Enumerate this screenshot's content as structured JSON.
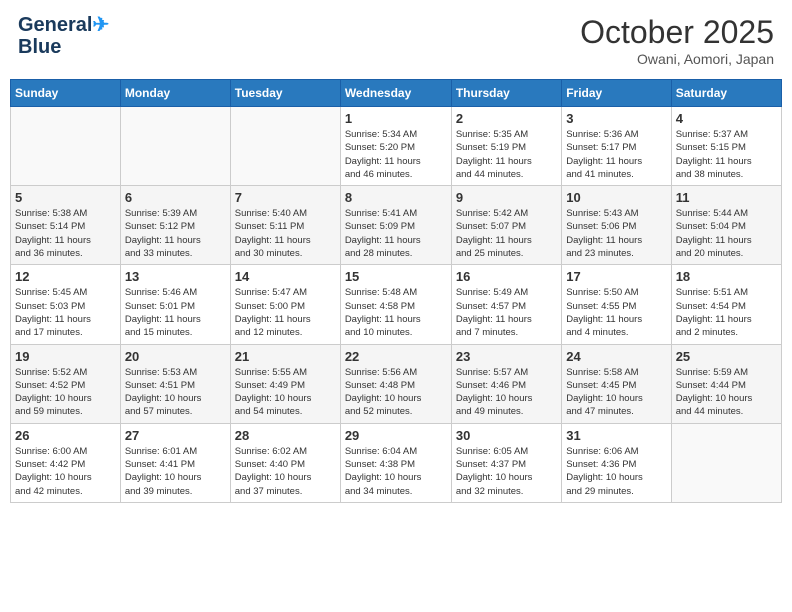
{
  "header": {
    "logo_line1": "General",
    "logo_line2": "Blue",
    "month": "October 2025",
    "location": "Owani, Aomori, Japan"
  },
  "weekdays": [
    "Sunday",
    "Monday",
    "Tuesday",
    "Wednesday",
    "Thursday",
    "Friday",
    "Saturday"
  ],
  "weeks": [
    [
      {
        "day": "",
        "info": ""
      },
      {
        "day": "",
        "info": ""
      },
      {
        "day": "",
        "info": ""
      },
      {
        "day": "1",
        "info": "Sunrise: 5:34 AM\nSunset: 5:20 PM\nDaylight: 11 hours\nand 46 minutes."
      },
      {
        "day": "2",
        "info": "Sunrise: 5:35 AM\nSunset: 5:19 PM\nDaylight: 11 hours\nand 44 minutes."
      },
      {
        "day": "3",
        "info": "Sunrise: 5:36 AM\nSunset: 5:17 PM\nDaylight: 11 hours\nand 41 minutes."
      },
      {
        "day": "4",
        "info": "Sunrise: 5:37 AM\nSunset: 5:15 PM\nDaylight: 11 hours\nand 38 minutes."
      }
    ],
    [
      {
        "day": "5",
        "info": "Sunrise: 5:38 AM\nSunset: 5:14 PM\nDaylight: 11 hours\nand 36 minutes."
      },
      {
        "day": "6",
        "info": "Sunrise: 5:39 AM\nSunset: 5:12 PM\nDaylight: 11 hours\nand 33 minutes."
      },
      {
        "day": "7",
        "info": "Sunrise: 5:40 AM\nSunset: 5:11 PM\nDaylight: 11 hours\nand 30 minutes."
      },
      {
        "day": "8",
        "info": "Sunrise: 5:41 AM\nSunset: 5:09 PM\nDaylight: 11 hours\nand 28 minutes."
      },
      {
        "day": "9",
        "info": "Sunrise: 5:42 AM\nSunset: 5:07 PM\nDaylight: 11 hours\nand 25 minutes."
      },
      {
        "day": "10",
        "info": "Sunrise: 5:43 AM\nSunset: 5:06 PM\nDaylight: 11 hours\nand 23 minutes."
      },
      {
        "day": "11",
        "info": "Sunrise: 5:44 AM\nSunset: 5:04 PM\nDaylight: 11 hours\nand 20 minutes."
      }
    ],
    [
      {
        "day": "12",
        "info": "Sunrise: 5:45 AM\nSunset: 5:03 PM\nDaylight: 11 hours\nand 17 minutes."
      },
      {
        "day": "13",
        "info": "Sunrise: 5:46 AM\nSunset: 5:01 PM\nDaylight: 11 hours\nand 15 minutes."
      },
      {
        "day": "14",
        "info": "Sunrise: 5:47 AM\nSunset: 5:00 PM\nDaylight: 11 hours\nand 12 minutes."
      },
      {
        "day": "15",
        "info": "Sunrise: 5:48 AM\nSunset: 4:58 PM\nDaylight: 11 hours\nand 10 minutes."
      },
      {
        "day": "16",
        "info": "Sunrise: 5:49 AM\nSunset: 4:57 PM\nDaylight: 11 hours\nand 7 minutes."
      },
      {
        "day": "17",
        "info": "Sunrise: 5:50 AM\nSunset: 4:55 PM\nDaylight: 11 hours\nand 4 minutes."
      },
      {
        "day": "18",
        "info": "Sunrise: 5:51 AM\nSunset: 4:54 PM\nDaylight: 11 hours\nand 2 minutes."
      }
    ],
    [
      {
        "day": "19",
        "info": "Sunrise: 5:52 AM\nSunset: 4:52 PM\nDaylight: 10 hours\nand 59 minutes."
      },
      {
        "day": "20",
        "info": "Sunrise: 5:53 AM\nSunset: 4:51 PM\nDaylight: 10 hours\nand 57 minutes."
      },
      {
        "day": "21",
        "info": "Sunrise: 5:55 AM\nSunset: 4:49 PM\nDaylight: 10 hours\nand 54 minutes."
      },
      {
        "day": "22",
        "info": "Sunrise: 5:56 AM\nSunset: 4:48 PM\nDaylight: 10 hours\nand 52 minutes."
      },
      {
        "day": "23",
        "info": "Sunrise: 5:57 AM\nSunset: 4:46 PM\nDaylight: 10 hours\nand 49 minutes."
      },
      {
        "day": "24",
        "info": "Sunrise: 5:58 AM\nSunset: 4:45 PM\nDaylight: 10 hours\nand 47 minutes."
      },
      {
        "day": "25",
        "info": "Sunrise: 5:59 AM\nSunset: 4:44 PM\nDaylight: 10 hours\nand 44 minutes."
      }
    ],
    [
      {
        "day": "26",
        "info": "Sunrise: 6:00 AM\nSunset: 4:42 PM\nDaylight: 10 hours\nand 42 minutes."
      },
      {
        "day": "27",
        "info": "Sunrise: 6:01 AM\nSunset: 4:41 PM\nDaylight: 10 hours\nand 39 minutes."
      },
      {
        "day": "28",
        "info": "Sunrise: 6:02 AM\nSunset: 4:40 PM\nDaylight: 10 hours\nand 37 minutes."
      },
      {
        "day": "29",
        "info": "Sunrise: 6:04 AM\nSunset: 4:38 PM\nDaylight: 10 hours\nand 34 minutes."
      },
      {
        "day": "30",
        "info": "Sunrise: 6:05 AM\nSunset: 4:37 PM\nDaylight: 10 hours\nand 32 minutes."
      },
      {
        "day": "31",
        "info": "Sunrise: 6:06 AM\nSunset: 4:36 PM\nDaylight: 10 hours\nand 29 minutes."
      },
      {
        "day": "",
        "info": ""
      }
    ]
  ]
}
